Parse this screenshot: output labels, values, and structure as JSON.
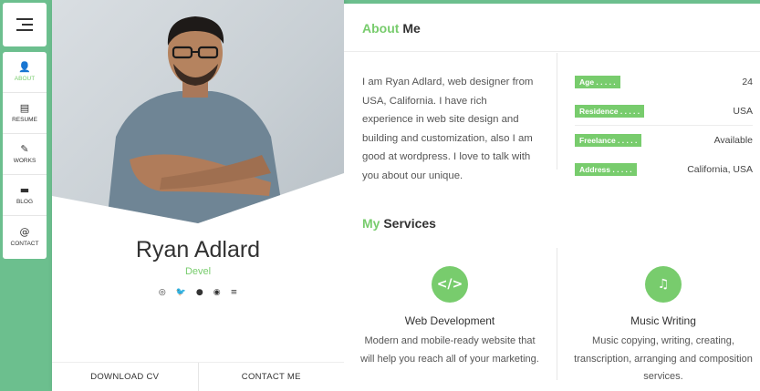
{
  "nav": {
    "menu_icon": "hamburger-icon",
    "items": [
      {
        "label": "ABOUT",
        "icon": "user-icon"
      },
      {
        "label": "RESUME",
        "icon": "document-icon"
      },
      {
        "label": "WORKS",
        "icon": "brush-icon"
      },
      {
        "label": "BLOG",
        "icon": "chat-icon"
      },
      {
        "label": "CONTACT",
        "icon": "at-icon"
      }
    ]
  },
  "profile": {
    "name": "Ryan Adlard",
    "role": "Devel",
    "social": [
      "dribbble-icon",
      "twitter-icon",
      "github-icon",
      "spotify-icon",
      "stackoverflow-icon"
    ],
    "download_cv": "DOWNLOAD CV",
    "contact_me": "CONTACT ME"
  },
  "about": {
    "title_highlight": "About",
    "title_rest": "Me",
    "bio": "I am Ryan Adlard, web designer from USA, California. I have rich experience in web site design and building and customization, also I am good at wordpress. I love to talk with you about our unique.",
    "info": [
      {
        "label": "Age . . . . .",
        "value": "24"
      },
      {
        "label": "Residence . . . . .",
        "value": "USA"
      },
      {
        "label": "Freelance . . . . .",
        "value": "Available"
      },
      {
        "label": "Address . . . . .",
        "value": "California, USA"
      }
    ]
  },
  "services": {
    "title_highlight": "My",
    "title_rest": "Services",
    "items": [
      {
        "icon": "code-icon",
        "glyph": "</>",
        "name": "Web Development",
        "desc": "Modern and mobile-ready website that will help you reach all of your marketing."
      },
      {
        "icon": "music-icon",
        "glyph": "♫",
        "name": "Music Writing",
        "desc": "Music copying, writing, creating, transcription, arranging and composition services."
      }
    ]
  },
  "colors": {
    "accent": "#78cc6d",
    "background": "#6cbf8e"
  }
}
